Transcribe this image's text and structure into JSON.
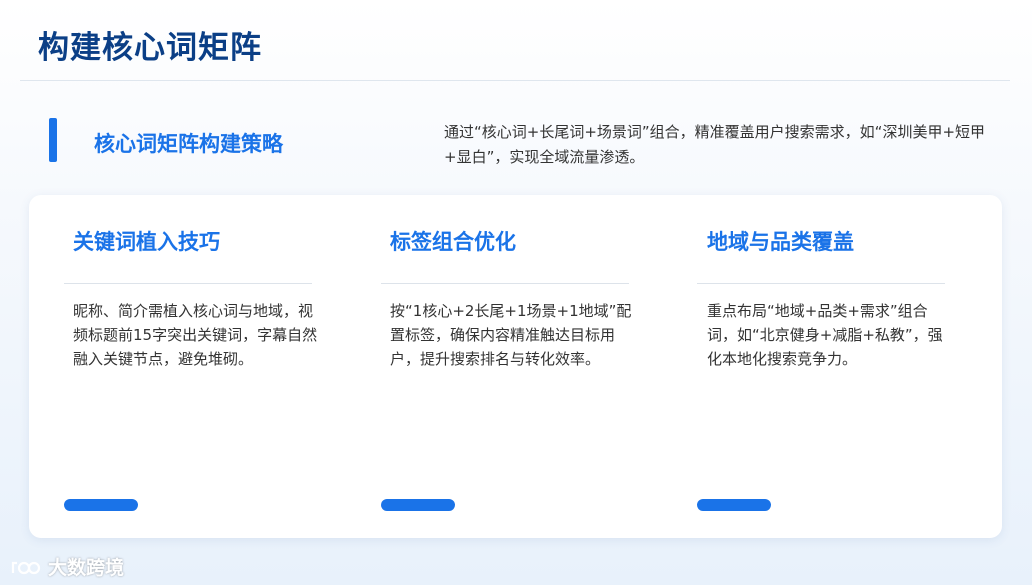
{
  "page_title": "构建核心词矩阵",
  "section": {
    "heading": "核心词矩阵构建策略",
    "description": "通过“核心词+长尾词+场景词”组合，精准覆盖用户搜索需求，如“深圳美甲+短甲+显白”，实现全域流量渗透。"
  },
  "columns": [
    {
      "title": "关键词植入技巧",
      "body": "昵称、简介需植入核心词与地域，视频标题前15字突出关键词，字幕自然融入关键节点，避免堆砌。"
    },
    {
      "title": "标签组合优化",
      "body": "按“1核心+2长尾+1场景+1地域”配置标签，确保内容精准触达目标用户，提升搜索排名与转化效率。"
    },
    {
      "title": "地域与品类覆盖",
      "body": "重点布局“地域+品类+需求”组合词，如“北京健身+减脂+私教”，强化本地化搜索竞争力。"
    }
  ],
  "watermark": "大数跨境",
  "colors": {
    "title": "#0b3f86",
    "accent": "#1a73e8",
    "text": "#333333"
  }
}
